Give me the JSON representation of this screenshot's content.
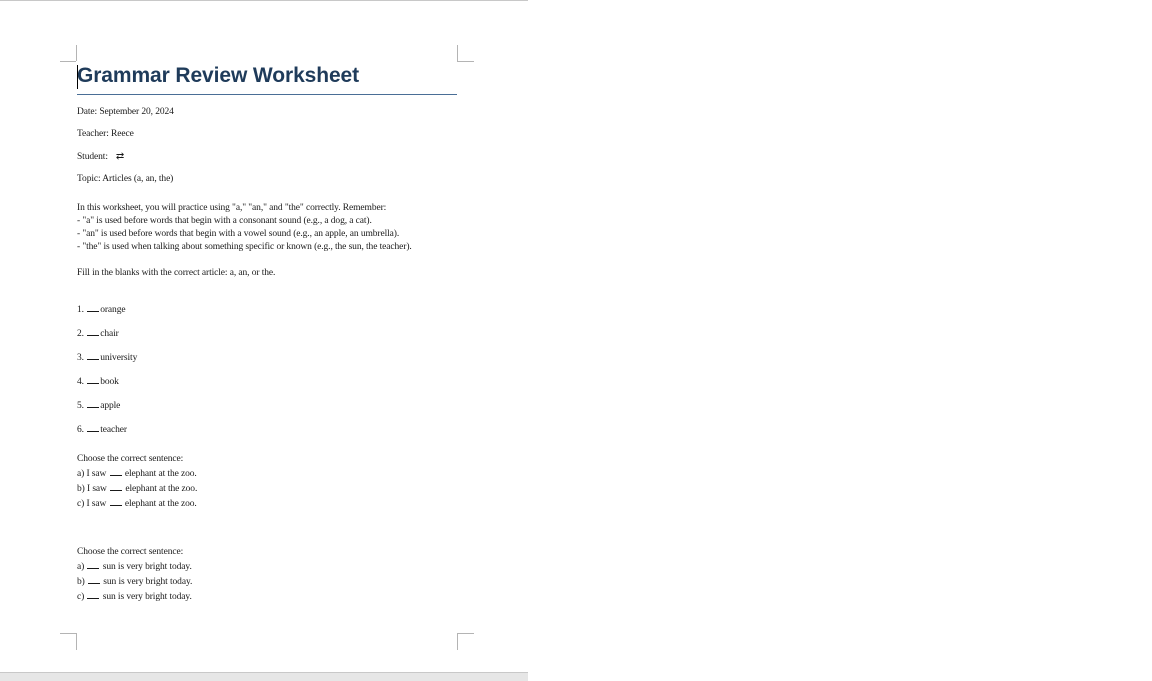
{
  "document": {
    "title": "Grammar Review Worksheet",
    "date_line": "Date: September 20, 2024",
    "teacher_line": "Teacher: Reece",
    "student_label": "Student:",
    "student_icon": "text-direction-icon",
    "topic_line": "Topic: Articles (a, an, the)",
    "intro_lines": [
      "In this worksheet, you will practice using \"a,\" \"an,\" and \"the\" correctly. Remember:",
      "- \"a\" is used before words that begin with a consonant sound (e.g., a dog, a cat).",
      "- \"an\" is used before words that begin with a vowel sound (e.g., an apple, an umbrella).",
      "- \"the\" is used when talking about something specific or known (e.g., the sun, the teacher)."
    ],
    "instruction": "Fill in the blanks with the correct article: a, an, or the.",
    "items": [
      {
        "number": "1.",
        "word": "orange"
      },
      {
        "number": "2.",
        "word": "chair"
      },
      {
        "number": "3.",
        "word": "university"
      },
      {
        "number": "4.",
        "word": "book"
      },
      {
        "number": "5.",
        "word": "apple"
      },
      {
        "number": "6.",
        "word": "teacher"
      }
    ],
    "choice_sets": [
      {
        "heading": "Choose the correct sentence:",
        "options": [
          {
            "prefix": "a) I saw",
            "suffix": "elephant at the zoo."
          },
          {
            "prefix": "b) I saw",
            "suffix": "elephant at the zoo."
          },
          {
            "prefix": "c) I saw",
            "suffix": "elephant at the zoo."
          }
        ]
      },
      {
        "heading": "Choose the correct sentence:",
        "options": [
          {
            "prefix": "a)",
            "suffix": "sun is very bright today."
          },
          {
            "prefix": "b)",
            "suffix": "sun is very bright today."
          },
          {
            "prefix": "c)",
            "suffix": "sun is very bright today."
          }
        ]
      }
    ]
  }
}
